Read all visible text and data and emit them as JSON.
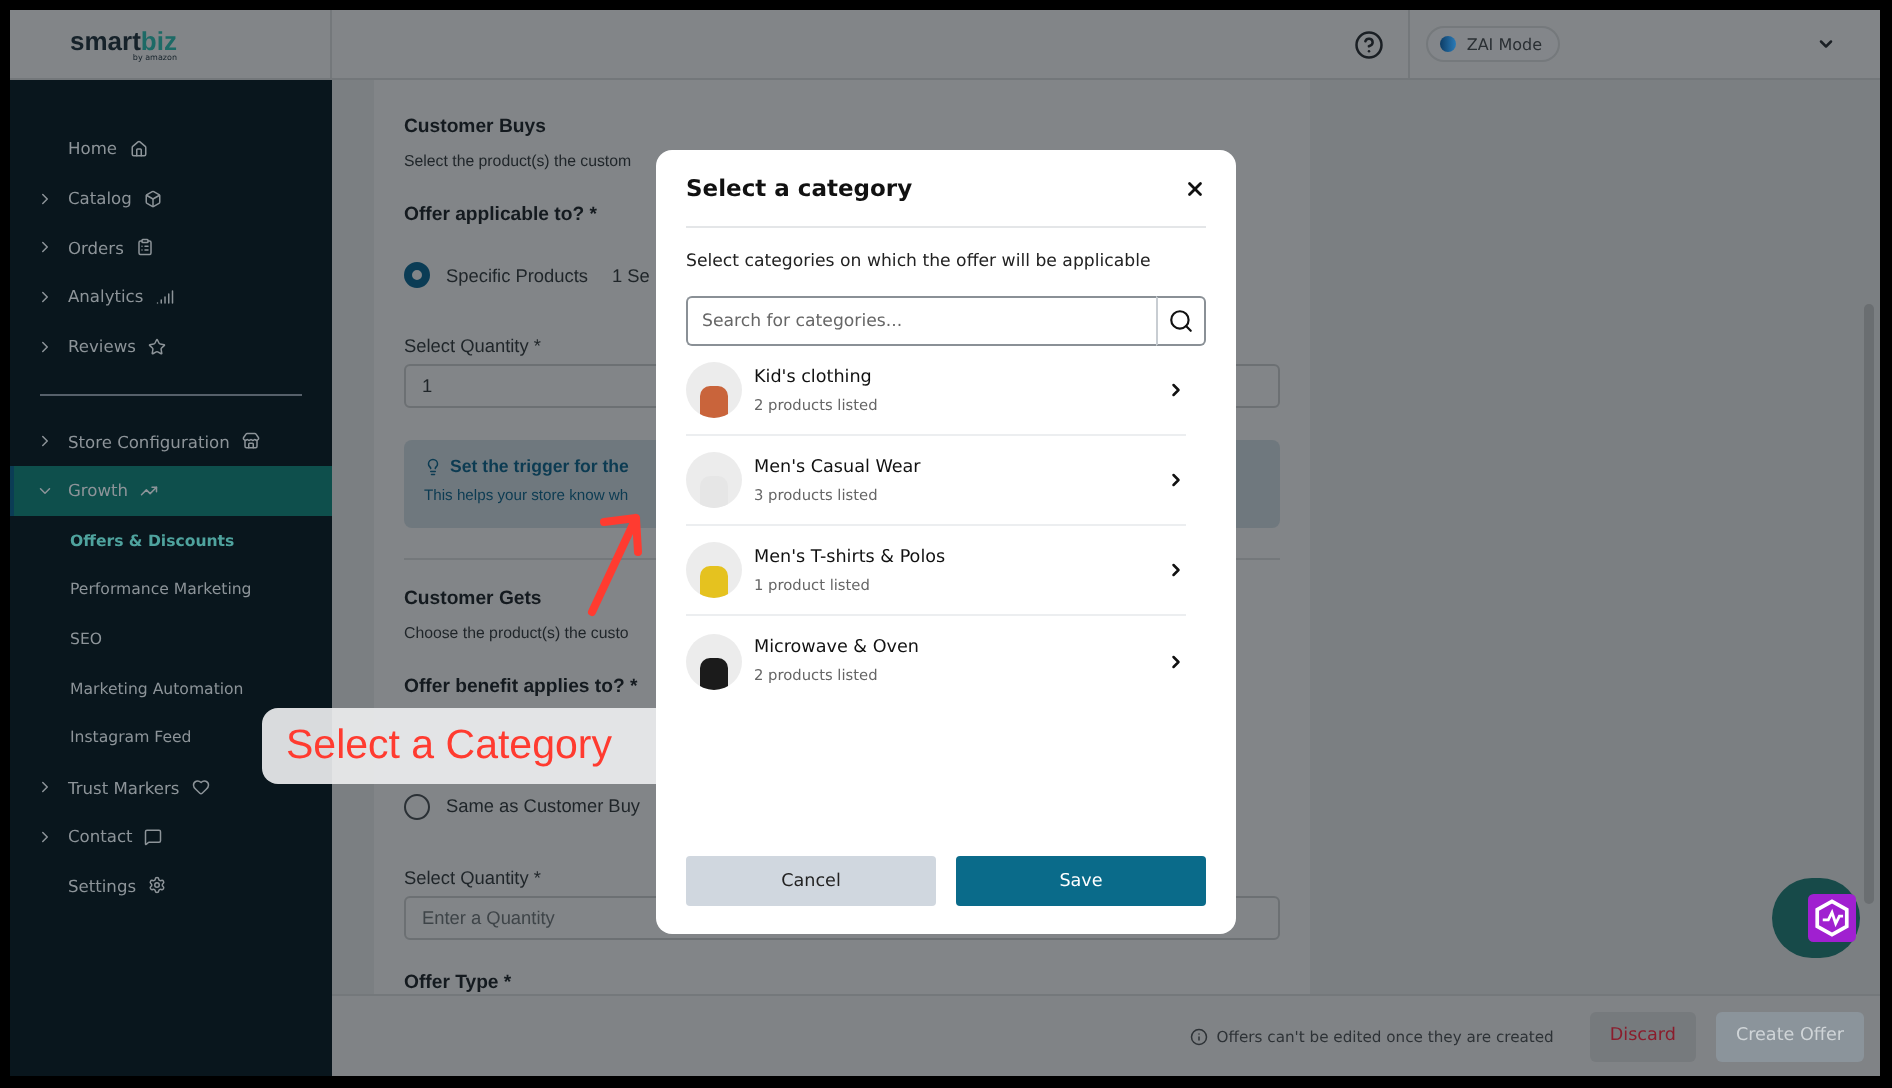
{
  "header": {
    "logo": {
      "text_1": "sm",
      "text_2": "art",
      "text_3": "biz",
      "tagline": "by amazon"
    },
    "mode_toggle": "ZAI Mode"
  },
  "sidebar": {
    "items": [
      {
        "label": "Home",
        "kind": "link",
        "selected": false
      },
      {
        "label": "Catalog",
        "kind": "group",
        "expanded": false,
        "selected": false
      },
      {
        "label": "Orders",
        "kind": "group",
        "expanded": false,
        "selected": false
      },
      {
        "label": "Analytics",
        "kind": "group",
        "expanded": false,
        "selected": false
      },
      {
        "label": "Reviews",
        "kind": "group",
        "expanded": false,
        "selected": false
      },
      {
        "kind": "divider"
      },
      {
        "label": "Store Configuration",
        "kind": "group",
        "expanded": false,
        "selected": false
      },
      {
        "label": "Growth",
        "kind": "group",
        "expanded": true,
        "selected": true,
        "children": [
          {
            "label": "Offers & Discounts",
            "selected": true
          },
          {
            "label": "Performance Marketing",
            "selected": false
          },
          {
            "label": "SEO",
            "selected": false
          },
          {
            "label": "Marketing Automation",
            "selected": false
          },
          {
            "label": "Instagram Feed",
            "selected": false
          }
        ]
      },
      {
        "label": "Trust Markers",
        "kind": "group",
        "expanded": false,
        "selected": false
      },
      {
        "label": "Contact",
        "kind": "group",
        "expanded": false,
        "selected": false
      },
      {
        "label": "Settings",
        "kind": "link",
        "selected": false
      }
    ]
  },
  "form": {
    "sections": [
      {
        "title": "Customer Buys",
        "subtitle": "Select the product(s) the custom",
        "question": "Offer applicable to? *",
        "options": [
          {
            "label": "Specific Products",
            "note": "1 Se",
            "selected": true
          }
        ],
        "quantity_label": "Select Quantity *",
        "quantity": {
          "value": "1"
        },
        "tip": {
          "title": "Set the trigger for the",
          "text": "This helps your store know wh"
        }
      },
      {
        "title": "Customer Gets",
        "subtitle": "Choose the product(s) the custo",
        "question": "Offer benefit applies to? *",
        "options": [
          {
            "label": "Same as Customer Buy",
            "selected": false
          }
        ],
        "quantity_label": "Select Quantity *",
        "quantity": {
          "placeholder": "Enter a Quantity"
        }
      }
    ],
    "next_label": "Offer Type *"
  },
  "footer": {
    "notice": "Offers can't be edited once they are created",
    "buttons": [
      {
        "label": "Discard",
        "kind": "danger",
        "disabled": false
      },
      {
        "label": "Create Offer",
        "kind": "primary",
        "disabled": true
      }
    ]
  },
  "callout": {
    "text": "Select a Category"
  },
  "dialog": {
    "title": "Select a category",
    "subtitle": "Select categories on which the offer will be applicable",
    "search": {
      "placeholder": "Search for categories..."
    },
    "categories": [
      {
        "name": "Kid's clothing",
        "count": "2 products listed"
      },
      {
        "name": "Men's Casual Wear",
        "count": "3 products listed"
      },
      {
        "name": "Men's T-shirts & Polos",
        "count": "1 product listed"
      },
      {
        "name": "Microwave & Oven",
        "count": "2 products listed"
      }
    ],
    "buttons": [
      {
        "label": "Cancel",
        "kind": "secondary"
      },
      {
        "label": "Save",
        "kind": "primary"
      }
    ]
  }
}
